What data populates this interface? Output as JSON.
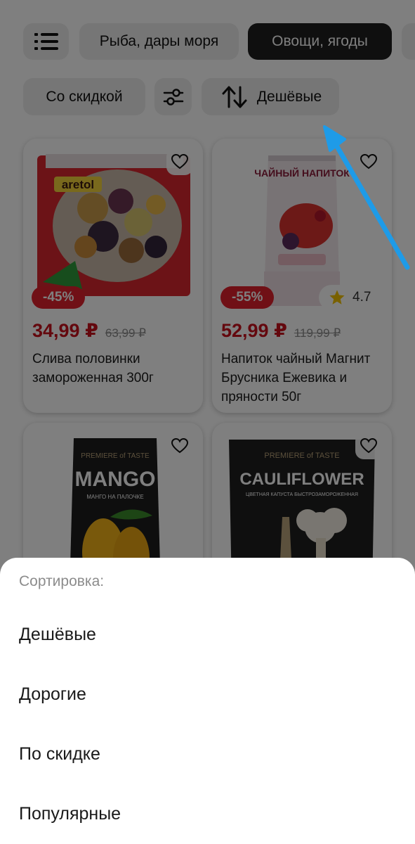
{
  "categories": {
    "menu_icon": "list-icon",
    "items": [
      "Рыба, дары моря",
      "Овощи, ягоды"
    ]
  },
  "filters": {
    "discount_label": "Со скидкой",
    "settings_icon": "sliders-icon",
    "sort_icon": "sort-arrows-icon",
    "sort_label": "Дешёвые"
  },
  "products": [
    {
      "badge": "-45%",
      "price": "34,99 ₽",
      "old_price": "63,99 ₽",
      "title": "Слива половинки замороженная 300г",
      "package_text": "aretol"
    },
    {
      "badge": "-55%",
      "rating": "4.7",
      "price": "52,99 ₽",
      "old_price": "119,99 ₽",
      "title": "Напиток чайный Магнит Брусника Ежевика и пряности 50г",
      "package_text": "ЧАЙНЫЙ НАПИТОК"
    },
    {
      "package_brand": "PREMIERE of TASTE",
      "package_text": "MANGO",
      "package_sub": "МАНГО НА ПАЛОЧКЕ"
    },
    {
      "package_brand": "PREMIERE of TASTE",
      "package_text": "CAULIFLOWER",
      "package_sub": "ЦВЕТНАЯ КАПУСТА БЫСТРОЗАМОРОЖЕННАЯ"
    }
  ],
  "sort_sheet": {
    "title": "Сортировка:",
    "options": [
      "Дешёвые",
      "Дорогие",
      "По скидке",
      "Популярные"
    ]
  },
  "colors": {
    "accent_price": "#c8101c",
    "discount_badge": "#e0202c",
    "active_chip": "#1f1f1f",
    "arrow": "#1e9be8",
    "star": "#f2c200"
  }
}
